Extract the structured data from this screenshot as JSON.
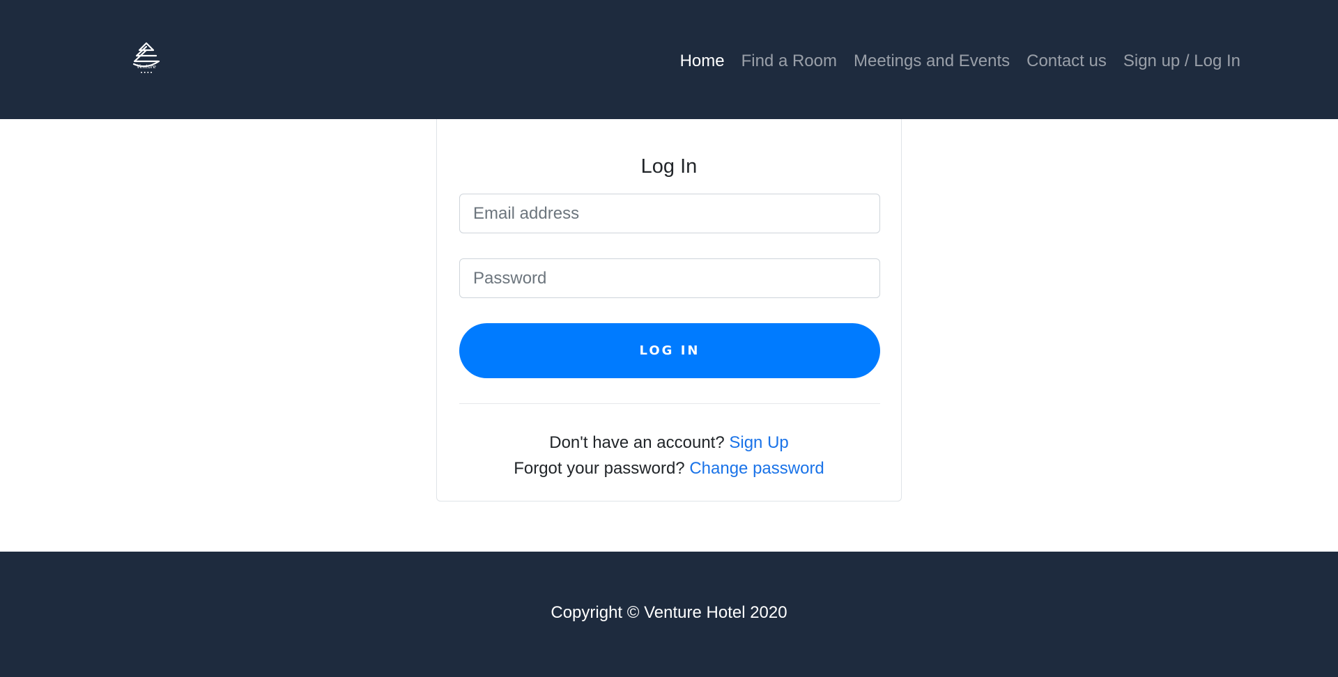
{
  "brand": {
    "logo_text": "Venture",
    "logo_icon": "venture-hotel-logo"
  },
  "nav": {
    "items": [
      {
        "label": "Home",
        "active": true
      },
      {
        "label": "Find a Room",
        "active": false
      },
      {
        "label": "Meetings and Events",
        "active": false
      },
      {
        "label": "Contact us",
        "active": false
      },
      {
        "label": "Sign up / Log In",
        "active": false
      }
    ]
  },
  "login": {
    "title": "Log In",
    "email_placeholder": "Email address",
    "email_value": "",
    "password_placeholder": "Password",
    "password_value": "",
    "button_label": "LOG IN",
    "signup_prompt": "Don't have an account?",
    "signup_link": "Sign Up",
    "forgot_prompt": "Forgot your password?",
    "forgot_link": "Change password"
  },
  "footer": {
    "copyright": "Copyright © Venture Hotel 2020"
  },
  "colors": {
    "header_bg": "#1e2b3e",
    "accent": "#007bff",
    "link": "#1a73e8"
  }
}
